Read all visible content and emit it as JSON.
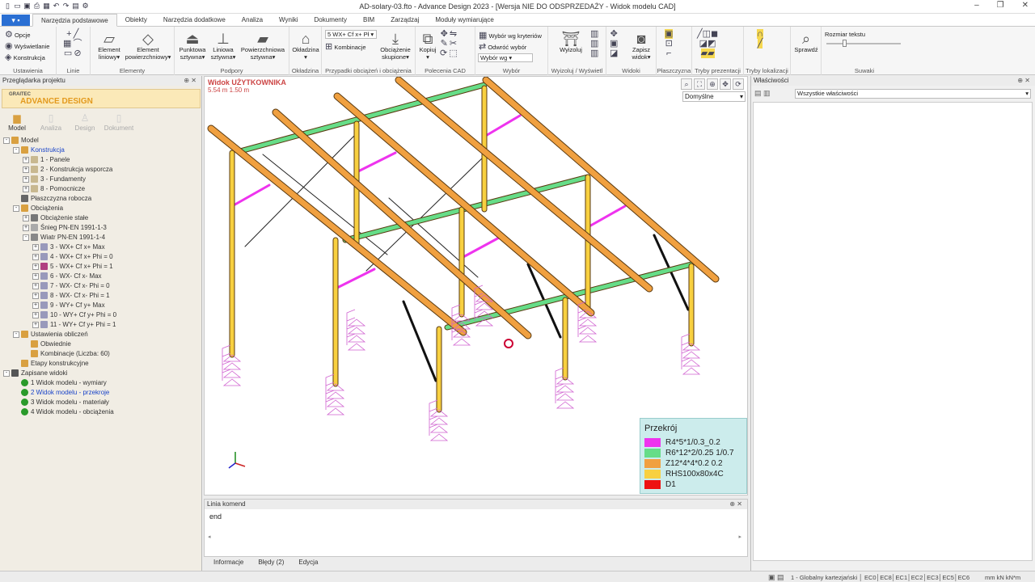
{
  "window": {
    "title": "AD-solary-03.fto - Advance Design 2023 - [Wersja NIE DO ODSPRZEDAŻY - Widok modelu CAD]"
  },
  "tabs": [
    "Narzędzia podstawowe",
    "Obiekty",
    "Narzędzia dodatkowe",
    "Analiza",
    "Wyniki",
    "Dokumenty",
    "BIM",
    "Zarządzaj",
    "Moduły wymiarujące"
  ],
  "ribbon": {
    "ustawienia": {
      "opcje": "Opcje",
      "wyswietlanie": "Wyświetlanie",
      "konstrukcja": "Konstrukcja",
      "label": "Ustawienia"
    },
    "linie": {
      "label": "Linie"
    },
    "elementy": {
      "liniowy_1": "Element",
      "liniowy_2": "liniowy",
      "powierzchniowy_1": "Element",
      "powierzchniowy_2": "powierzchniowy",
      "label": "Elementy"
    },
    "podpory": {
      "punktowa_1": "Punktowa",
      "punktowa_2": "sztywna",
      "liniowa_1": "Liniowa",
      "liniowa_2": "sztywna",
      "powierzchniowa_1": "Powierzchniowa",
      "powierzchniowa_2": "sztywna",
      "label": "Podpory"
    },
    "okladzina": {
      "btn": "Okładzina",
      "label": "Okładzina"
    },
    "przypadki": {
      "combo": "5 WX+ Cf x+ Pł",
      "kombinacje": "Kombinacje",
      "obciazenie_1": "Obciążenie",
      "obciazenie_2": "skupione",
      "label": "Przypadki obciążeń i obciążenia"
    },
    "cad": {
      "kopiuj": "Kopiuj",
      "label": "Polecenia CAD"
    },
    "wybor": {
      "kryteria": "Wybór wg kryteriów",
      "odwroc": "Odwróć wybór",
      "wg": "Wybór wg",
      "label": "Wybór"
    },
    "wyizoluj": {
      "btn": "Wyizoluj",
      "label": "Wyizoluj / Wyświetl"
    },
    "widoki": {
      "zapisz_1": "Zapisz",
      "zapisz_2": "widok",
      "label": "Widoki"
    },
    "plaszczyzna": {
      "label": "Płaszczyzna"
    },
    "tryby_prezentacji": {
      "label": "Tryby prezentacji"
    },
    "tryby_lokalizacji": {
      "label": "Tryby lokalizacji"
    },
    "sprawdz": {
      "btn": "Sprawdź"
    },
    "suwaki": {
      "rozmiar": "Rozmiar tekstu",
      "label": "Suwaki"
    }
  },
  "left_panel": {
    "title": "Przeglądarka projektu",
    "logo_a": "GRAITEC",
    "logo_b": "ADVANCE DESIGN",
    "modes": [
      "Model",
      "Analiza",
      "Design",
      "Dokument"
    ],
    "tree": [
      {
        "text": "Model",
        "level": 0,
        "exp": "-",
        "color": "#d9a040"
      },
      {
        "text": "Konstrukcja",
        "level": 1,
        "exp": "-",
        "color": "#d9a040",
        "blue": true
      },
      {
        "text": "1 - Panele",
        "level": 2,
        "exp": "+",
        "color": "#c8b890"
      },
      {
        "text": "2 - Konstrukcja wsporcza",
        "level": 2,
        "exp": "+",
        "color": "#c8b890"
      },
      {
        "text": "3 - Fundamenty",
        "level": 2,
        "exp": "+",
        "color": "#c8b890"
      },
      {
        "text": "8 - Pomocnicze",
        "level": 2,
        "exp": "+",
        "color": "#c8b890"
      },
      {
        "text": "Płaszczyzna robocza",
        "level": 1,
        "exp": "",
        "color": "#666"
      },
      {
        "text": "Obciążenia",
        "level": 1,
        "exp": "-",
        "color": "#d9a040"
      },
      {
        "text": "Obciążenie stałe",
        "level": 2,
        "exp": "+",
        "color": "#777"
      },
      {
        "text": "Śnieg PN-EN 1991-1-3",
        "level": 2,
        "exp": "+",
        "color": "#aaa"
      },
      {
        "text": "Wiatr PN-EN 1991-1-4",
        "level": 2,
        "exp": "-",
        "color": "#888"
      },
      {
        "text": "3 - WX+ Cf x+ Max",
        "level": 3,
        "exp": "+",
        "color": "#9999bb"
      },
      {
        "text": "4 - WX+ Cf x+ Phi = 0",
        "level": 3,
        "exp": "+",
        "color": "#9999bb"
      },
      {
        "text": "5 - WX+ Cf x+ Phi = 1",
        "level": 3,
        "exp": "+",
        "color": "#b04080"
      },
      {
        "text": "6 - WX- Cf x- Max",
        "level": 3,
        "exp": "+",
        "color": "#9999bb"
      },
      {
        "text": "7 - WX- Cf x- Phi = 0",
        "level": 3,
        "exp": "+",
        "color": "#9999bb"
      },
      {
        "text": "8 - WX- Cf x- Phi = 1",
        "level": 3,
        "exp": "+",
        "color": "#9999bb"
      },
      {
        "text": "9 - WY+ Cf y+ Max",
        "level": 3,
        "exp": "+",
        "color": "#9999bb"
      },
      {
        "text": "10 - WY+ Cf y+ Phi = 0",
        "level": 3,
        "exp": "+",
        "color": "#9999bb"
      },
      {
        "text": "11 - WY+ Cf y+ Phi = 1",
        "level": 3,
        "exp": "+",
        "color": "#9999bb"
      },
      {
        "text": "Ustawienia obliczeń",
        "level": 1,
        "exp": "-",
        "color": "#d9a040"
      },
      {
        "text": "Obwiednie",
        "level": 2,
        "exp": "",
        "color": "#d9a040"
      },
      {
        "text": "Kombinacje (Liczba: 60)",
        "level": 2,
        "exp": "",
        "color": "#d9a040"
      },
      {
        "text": "Etapy konstrukcyjne",
        "level": 1,
        "exp": "",
        "color": "#d9a040"
      },
      {
        "text": "Zapisane widoki",
        "level": 0,
        "exp": "-",
        "color": "#555"
      },
      {
        "text": "1 Widok modelu - wymiary",
        "level": 1,
        "exp": "",
        "color": "#2a9a2a",
        "dot": true
      },
      {
        "text": "2 Widok modelu - przekroje",
        "level": 1,
        "exp": "",
        "color": "#2a9a2a",
        "dot": true,
        "blue": true
      },
      {
        "text": "3 Widok modelu - materiały",
        "level": 1,
        "exp": "",
        "color": "#2a9a2a",
        "dot": true
      },
      {
        "text": "4 Widok modelu - obciążenia",
        "level": 1,
        "exp": "",
        "color": "#2a9a2a",
        "dot": true
      }
    ]
  },
  "view": {
    "title": "Widok UŻYTKOWNIKA",
    "subtitle": "5.54 m  1.50 m",
    "combo": "Domyślne"
  },
  "legend": {
    "title": "Przekrój",
    "items": [
      {
        "label": "R4*5*1/0.3_0.2",
        "color": "#ee33ee"
      },
      {
        "label": "R6*12*2/0.25 1/0.7",
        "color": "#66dd88"
      },
      {
        "label": "Z12*4*4*0.2 0.2",
        "color": "#f0a040"
      },
      {
        "label": "RHS100x80x4C",
        "color": "#f8d040"
      },
      {
        "label": "D1",
        "color": "#ee1111"
      }
    ]
  },
  "command": {
    "title": "Linia komend",
    "text": "end",
    "tabs": [
      "Informacje",
      "Błędy (2)",
      "Edycja"
    ]
  },
  "properties": {
    "title": "Właściwości",
    "combo": "Wszystkie właściwości"
  },
  "status": {
    "text": "1 - Globalny kartezjański │ EC0│EC8│EC1│EC2│EC3│EC5│EC6",
    "units": "mm  kN  kN*m"
  }
}
